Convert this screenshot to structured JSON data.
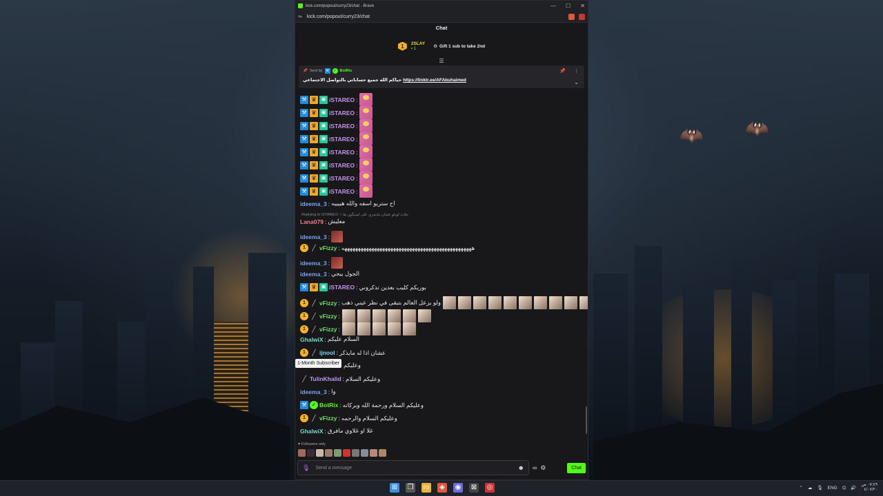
{
  "browser": {
    "title": "kick.com/popout/curry23/chat - Brave",
    "url": "kick.com/popout/curry23/chat"
  },
  "chat": {
    "header": "Chat",
    "leaderboard": {
      "rank": "1",
      "name": "2SLAY",
      "count": "1",
      "gift_text": "Gift 1 sub to take 2nd"
    },
    "pinned": {
      "sent_by_label": "Sent by",
      "sender": "BotRix",
      "text": "حياكم الله جميع حساباتي بالتواصل الاجتماعي",
      "link": "https://linktr.ee/AFAbuhaimed"
    },
    "messages": [
      {
        "user": "iSTAREO",
        "text": ""
      },
      {
        "user": "iSTAREO",
        "text": ""
      },
      {
        "user": "iSTAREO",
        "text": ""
      },
      {
        "user": "iSTAREO",
        "text": ""
      },
      {
        "user": "iSTAREO",
        "text": ""
      },
      {
        "user": "iSTAREO",
        "text": ""
      },
      {
        "user": "iSTAREO",
        "text": ""
      },
      {
        "user": "iSTAREO",
        "text": ""
      },
      {
        "user": "ideema_3",
        "text": "اح ستريو اسفه والله هييييه"
      },
      {
        "reply": "Replying to iSTAREO: حلات لوبلو عشان مايجري على لسبگون ها ١"
      },
      {
        "user": "Lana079",
        "text": "معليش"
      },
      {
        "user": "ideema_3",
        "text": ""
      },
      {
        "user": "vFizzy",
        "text": "ههههههههههههههههههههههههههههههههههههههههههههههههه"
      },
      {
        "user": "ideema_3",
        "text": ""
      },
      {
        "user": "ideema_3",
        "text": "الجول بيجي"
      },
      {
        "user": "iSTAREO",
        "text": "بوريكم كليب بعدين تذكروني"
      },
      {
        "user": "vFizzy",
        "text": "ولو يزعل العالم بتبقى في نظر عيني ذهب"
      },
      {
        "user": "vFizzy",
        "text": ""
      },
      {
        "user": "vFizzy",
        "text": ""
      },
      {
        "user": "GhalwiX",
        "text": "السلام عليكم"
      },
      {
        "user": "ijnool",
        "text": "عشان اذا له مايذكر"
      },
      {
        "user": "",
        "text": "وعليكم"
      },
      {
        "user": "TulinKhalid",
        "text": "وعليكم السلام"
      },
      {
        "user": "ideema_3",
        "text": "وا"
      },
      {
        "user": "BotRix",
        "text": "وعليكم السلام ورحمة الله وبركاته"
      },
      {
        "user": "vFizzy",
        "text": "وعليكم السلام والرحمه"
      },
      {
        "user": "GhalwiX",
        "text": "غلا او غلاوي مافرق"
      }
    ],
    "tooltip": "1-Month Subscriber",
    "followers_only": "Followers only",
    "input_placeholder": "Send a message",
    "send_label": "Chat"
  },
  "taskbar": {
    "lang": "ENG",
    "time": "٠٧:٤٩ ص",
    "date": "٤/٠٧/٢٠"
  }
}
